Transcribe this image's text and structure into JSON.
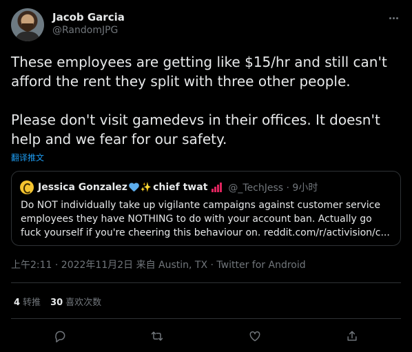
{
  "tweet": {
    "author_name": "Jacob Garcia",
    "author_handle": "@RandomJPG",
    "text": "These employees are getting like $15/hr and still can't afford the rent they split with three other people.\n\nPlease don't visit gamedevs in their offices. It doesn't help and we fear for our safety.",
    "translate_label": "翻译推文",
    "timestamp": "上午2:11 · 2022年11月2日 来自 Austin, TX · Twitter for Android"
  },
  "quote": {
    "name": "Jessica Gonzalez",
    "name_suffix": "chief twat",
    "handle_time": "@_TechJess · 9小时",
    "text": "Do NOT individually take up vigilante campaigns against customer service employees they have NOTHING to do with your account ban. Actually go fuck yourself if you're cheering this behaviour on. reddit.com/r/activision/c..."
  },
  "stats": {
    "retweets_count": "4",
    "retweets_label": "转推",
    "likes_count": "30",
    "likes_label": "喜欢次数"
  },
  "icons": {
    "more": "more-icon",
    "reply": "reply-icon",
    "retweet": "retweet-icon",
    "like": "heart-icon",
    "share": "share-icon"
  },
  "colors": {
    "background": "#000000",
    "text": "#e7e9ea",
    "muted": "#71767b",
    "link": "#1d9bf0",
    "border": "#2f3336"
  }
}
